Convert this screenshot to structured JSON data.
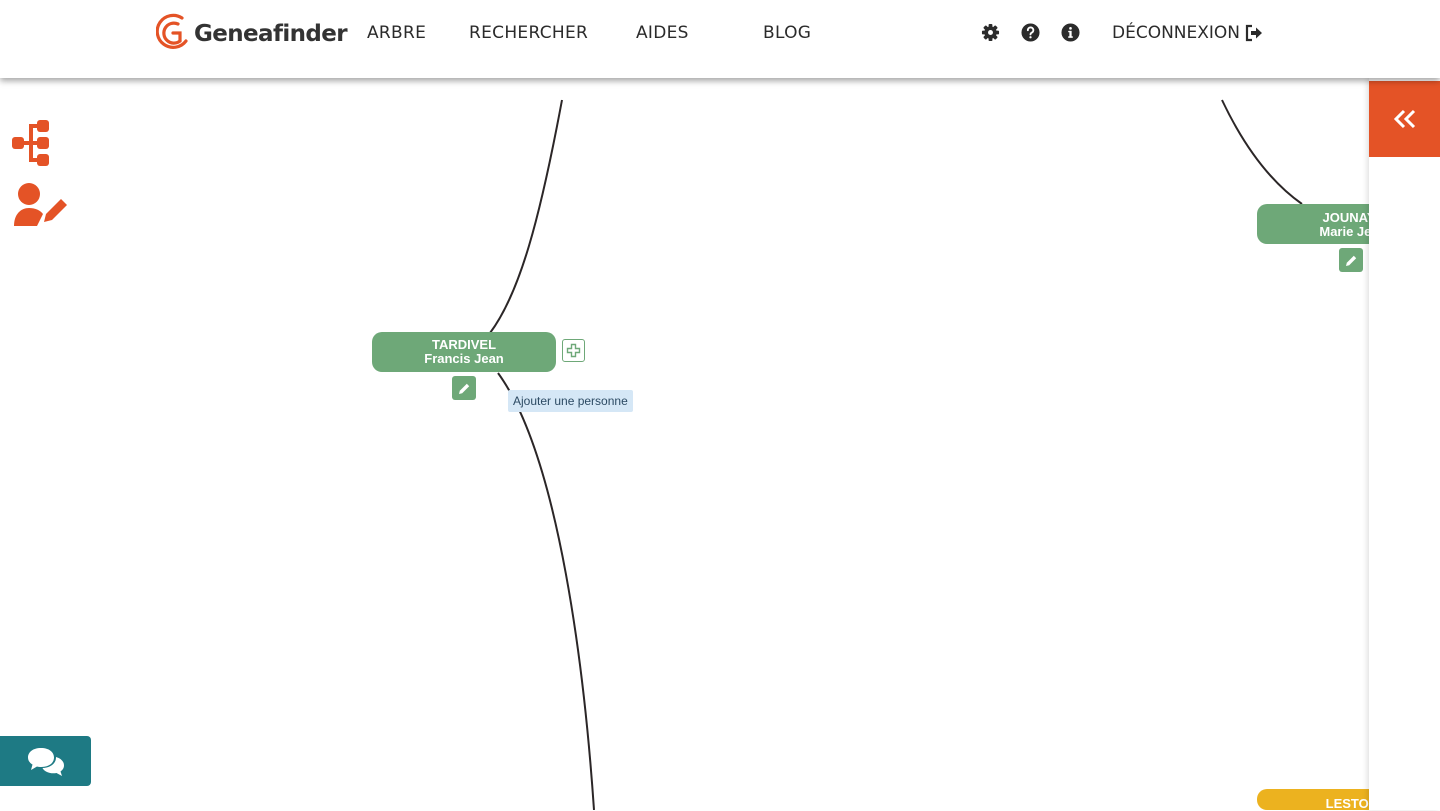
{
  "brand": {
    "name": "Geneafinder"
  },
  "nav": {
    "tree": "ARBRE",
    "search": "RECHERCHER",
    "help": "AIDES",
    "blog": "BLOG",
    "logout": "DÉCONNEXION"
  },
  "header_icons": [
    "gear-icon",
    "question-circle-icon",
    "info-circle-icon"
  ],
  "persons": [
    {
      "last": "TARDIVEL",
      "first": "Francis Jean",
      "color": "#6ea878"
    },
    {
      "last": "JOUNAY",
      "first": "Marie Jea",
      "color": "#6ea878"
    },
    {
      "last": "LESTOI",
      "first": "",
      "color": "#ecb21f"
    }
  ],
  "tooltip": {
    "add_person": "Ajouter une personne"
  },
  "colors": {
    "accent": "#e45326",
    "node_green": "#6ea878",
    "node_yellow": "#ecb21f",
    "chat": "#1e7a84"
  }
}
